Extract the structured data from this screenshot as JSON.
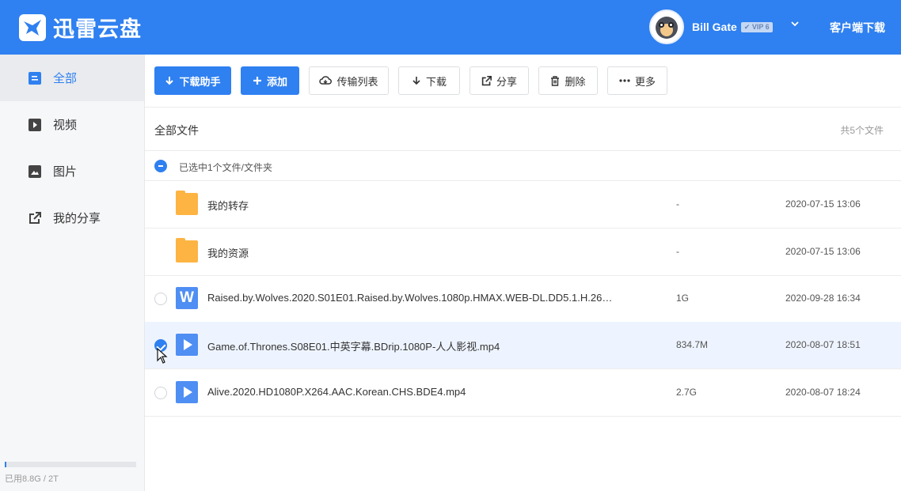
{
  "app": {
    "title": "迅雷云盘",
    "download_client": "客户端下载"
  },
  "user": {
    "name": "Bill Gate",
    "vip": "✔ VIP 6"
  },
  "sidebar": {
    "items": [
      {
        "label": "全部",
        "icon": "list-icon"
      },
      {
        "label": "视频",
        "icon": "video-icon"
      },
      {
        "label": "图片",
        "icon": "image-icon"
      },
      {
        "label": "我的分享",
        "icon": "share-out-icon"
      }
    ],
    "active": "全部",
    "storage": {
      "text": "已用8.8G / 2T",
      "used_fraction": 0.0043
    }
  },
  "toolbar": {
    "download_helper": "下载助手",
    "add": "添加",
    "transfer_list": "传输列表",
    "download": "下载",
    "share": "分享",
    "delete": "删除",
    "more": "更多"
  },
  "list": {
    "breadcrumb": "全部文件",
    "count": "共5个文件",
    "selection_text": "已选中1个文件/文件夹",
    "rows": [
      {
        "type": "folder",
        "name": "我的转存",
        "size": "-",
        "date": "2020-07-15 13:06",
        "selected": false
      },
      {
        "type": "folder",
        "name": "我的资源",
        "size": "-",
        "date": "2020-07-15 13:06",
        "selected": false
      },
      {
        "type": "word",
        "name": "Raised.by.Wolves.2020.S01E01.Raised.by.Wolves.1080p.HMAX.WEB-DL.DD5.1.H.26…",
        "size": "1G",
        "date": "2020-09-28 16:34",
        "selected": false,
        "icon_letter": "W"
      },
      {
        "type": "video",
        "name": "Game.of.Thrones.S08E01.中英字幕.BDrip.1080P-人人影视.mp4",
        "size": "834.7M",
        "date": "2020-08-07 18:51",
        "selected": true
      },
      {
        "type": "video",
        "name": "Alive.2020.HD1080P.X264.AAC.Korean.CHS.BDE4.mp4",
        "size": "2.7G",
        "date": "2020-08-07 18:24",
        "selected": false
      }
    ]
  },
  "colors": {
    "brand": "#2f80f0",
    "folder": "#fdb443",
    "file_icon": "#4f8ef3",
    "selected_row": "#eef4ff"
  }
}
